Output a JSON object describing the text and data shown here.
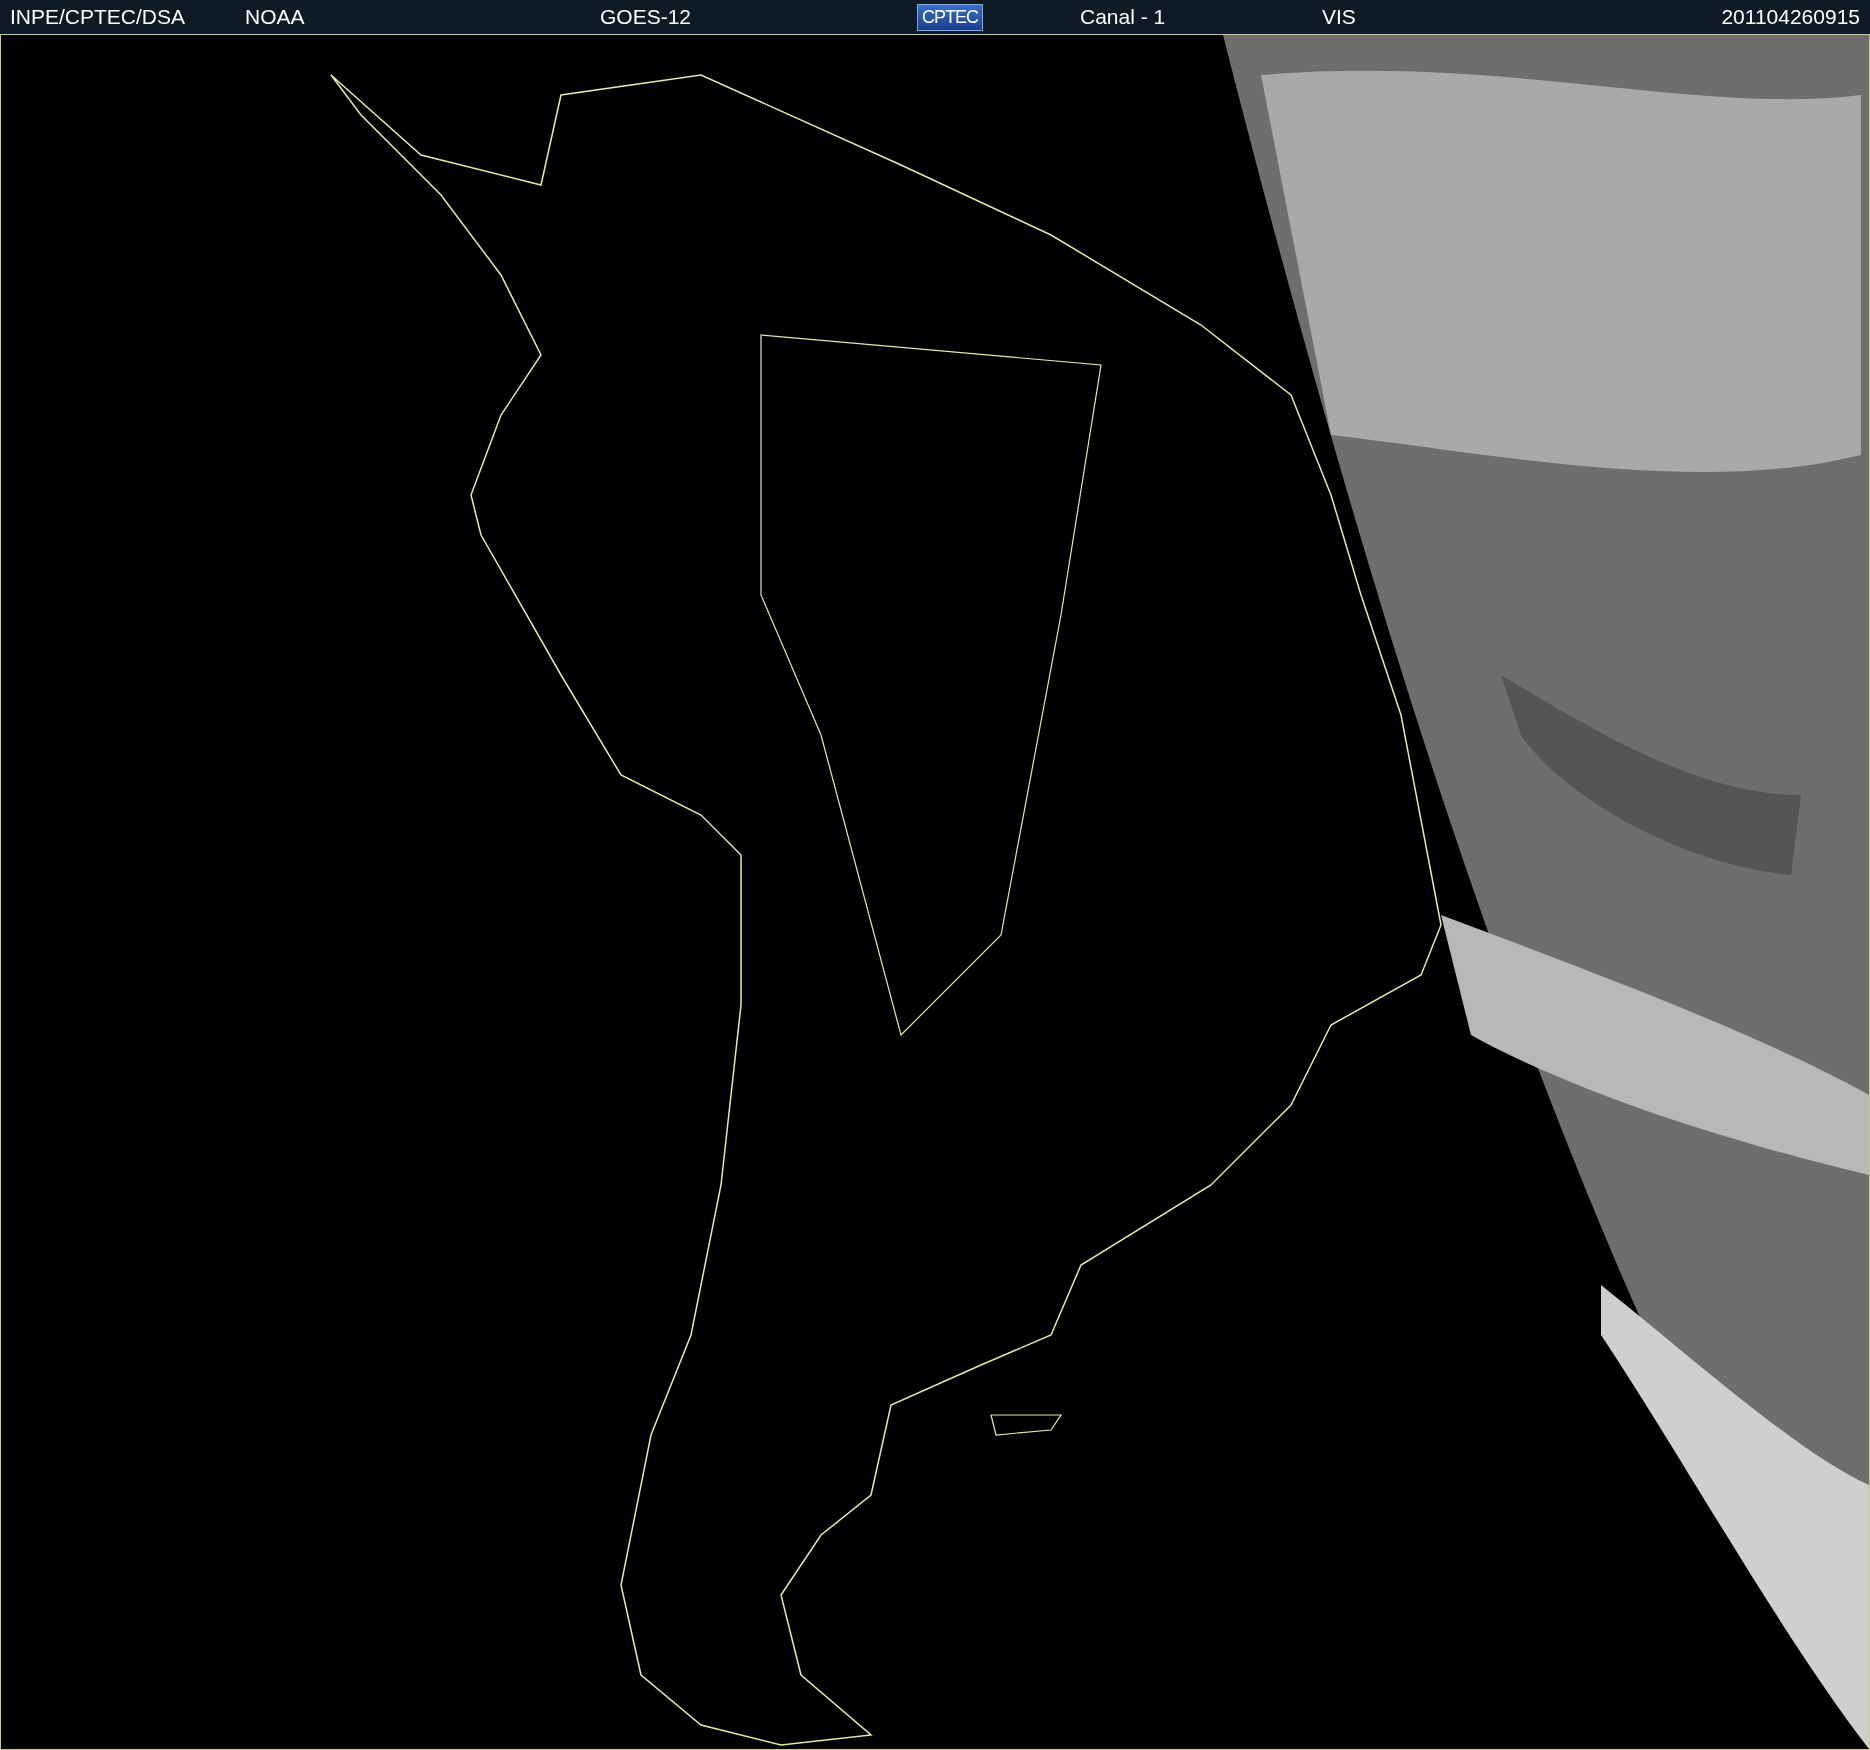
{
  "header": {
    "items": [
      {
        "kind": "text",
        "text": "INPE/CPTEC/DSA"
      },
      {
        "kind": "text",
        "text": "NOAA"
      },
      {
        "kind": "text",
        "text": "GOES-12"
      },
      {
        "kind": "logo",
        "text": "CPTEC"
      },
      {
        "kind": "text",
        "text": "Canal - 1"
      },
      {
        "kind": "text",
        "text": "VIS"
      },
      {
        "kind": "text",
        "text": "201104260915"
      }
    ]
  }
}
